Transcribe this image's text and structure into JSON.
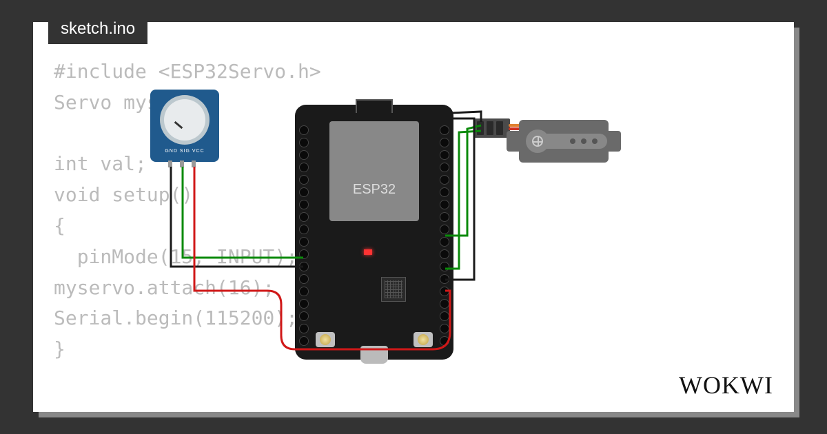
{
  "tab": {
    "filename": "sketch.ino"
  },
  "code": {
    "text": "#include <ESP32Servo.h>\nServo myse\n\nint val;\nvoid setup()\n{\n  pinMode(15, INPUT);\nmyservo.attach(16);\nSerial.begin(115200);\n}"
  },
  "components": {
    "potentiometer": {
      "pin_labels": "GND SIG VCC"
    },
    "esp32": {
      "chip_label": "ESP32"
    },
    "servo": {
      "name": "servo-motor"
    }
  },
  "wires": {
    "colors": {
      "gnd": "#1a1a1a",
      "sig": "#0a8a0a",
      "vcc": "#d01818",
      "servo_orange": "#e08030",
      "servo_red": "#d03020",
      "servo_brown": "#6a4a2a"
    }
  },
  "branding": {
    "logo": "WOKWI"
  }
}
